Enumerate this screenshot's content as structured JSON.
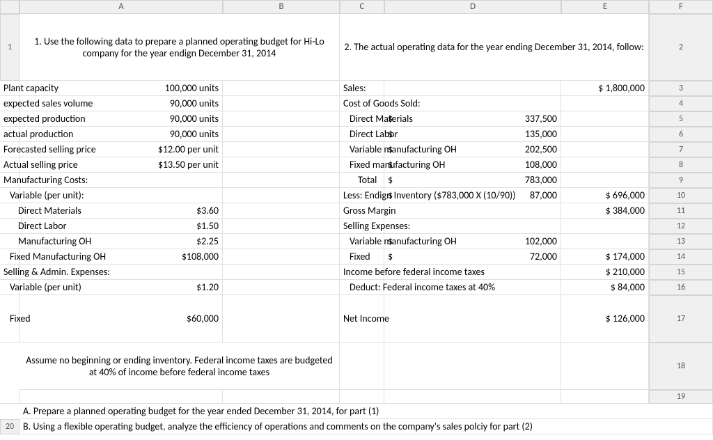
{
  "columns": [
    "A",
    "B",
    "C",
    "D",
    "E",
    "F"
  ],
  "rows": {
    "r1": {
      "a": "1. Use the following data to prepare a planned operating budget for Hi-Lo company for the year endign December 31, 2014",
      "d": "2. The actual operating data for the year ending December 31, 2014, follow:"
    },
    "r2": {
      "a": "Plant capacity",
      "b": "100,000 units",
      "d": "Sales:",
      "f": "$ 1,800,000"
    },
    "r3": {
      "a": "expected sales volume",
      "b": "90,000 units",
      "d": "Cost of Goods Sold:"
    },
    "r4": {
      "a": "expected production",
      "b": "90,000 units",
      "d": "Direct Materials",
      "e_s": "$",
      "e": "337,500"
    },
    "r5": {
      "a": "actual production",
      "b": "90,000 units",
      "d": "Direct Labor",
      "e_s": "$",
      "e": "135,000"
    },
    "r6": {
      "a": "Forecasted selling price",
      "b": "$12.00 per unit",
      "d": "Variable manufacturing OH",
      "e_s": "$",
      "e": "202,500"
    },
    "r7": {
      "a": "Actual selling price",
      "b": "$13.50 per unit",
      "d": "Fixed manufacturing OH",
      "e_s": "$",
      "e": "108,000"
    },
    "r8": {
      "a": "Manufacturing Costs:",
      "d": "Total",
      "e_s": "$",
      "e": "783,000"
    },
    "r9": {
      "a": "Variable (per unit):",
      "d": "Less: Endign Inventory ($783,000 X (10/90))",
      "e_s": "$",
      "e": "87,000",
      "f": "$   696,000"
    },
    "r10": {
      "a": "Direct Materials",
      "b": "$3.60",
      "d": "Gross Margin",
      "f": "$   384,000"
    },
    "r11": {
      "a": "Direct Labor",
      "b": "$1.50",
      "d": "Selling Expenses:"
    },
    "r12": {
      "a": "Manufacturing OH",
      "b": "$2.25",
      "d": "Variable manufacturing OH",
      "e_s": "$",
      "e": "102,000"
    },
    "r13": {
      "a": "Fixed Manufacturing OH",
      "b": "$108,000",
      "d": "Fixed",
      "e_s": "$",
      "e": "72,000",
      "f": "$   174,000"
    },
    "r14": {
      "a": "Selling & Admin. Expenses:",
      "d": "Income before federal income taxes",
      "f": "$   210,000"
    },
    "r15": {
      "a": "Variable (per unit)",
      "b": "$1.20",
      "d": "Deduct: Federal income taxes at 40%",
      "f": "$     84,000"
    },
    "r16": {
      "a": "Fixed",
      "b": "$60,000",
      "d": "Net Income",
      "f": "$   126,000"
    },
    "r17": {
      "a": "Assume no beginning or ending inventory. Federal income taxes are budgeted at 40% of income before federal income taxes"
    },
    "r19": {
      "a": "A. Prepare a planned operating budget for the year ended December 31, 2014, for part (1)"
    },
    "r20": {
      "a": "B. Using a flexible operating budget, analyze the efficiency of operations and comments on the company's sales polciy for part (2)"
    }
  }
}
